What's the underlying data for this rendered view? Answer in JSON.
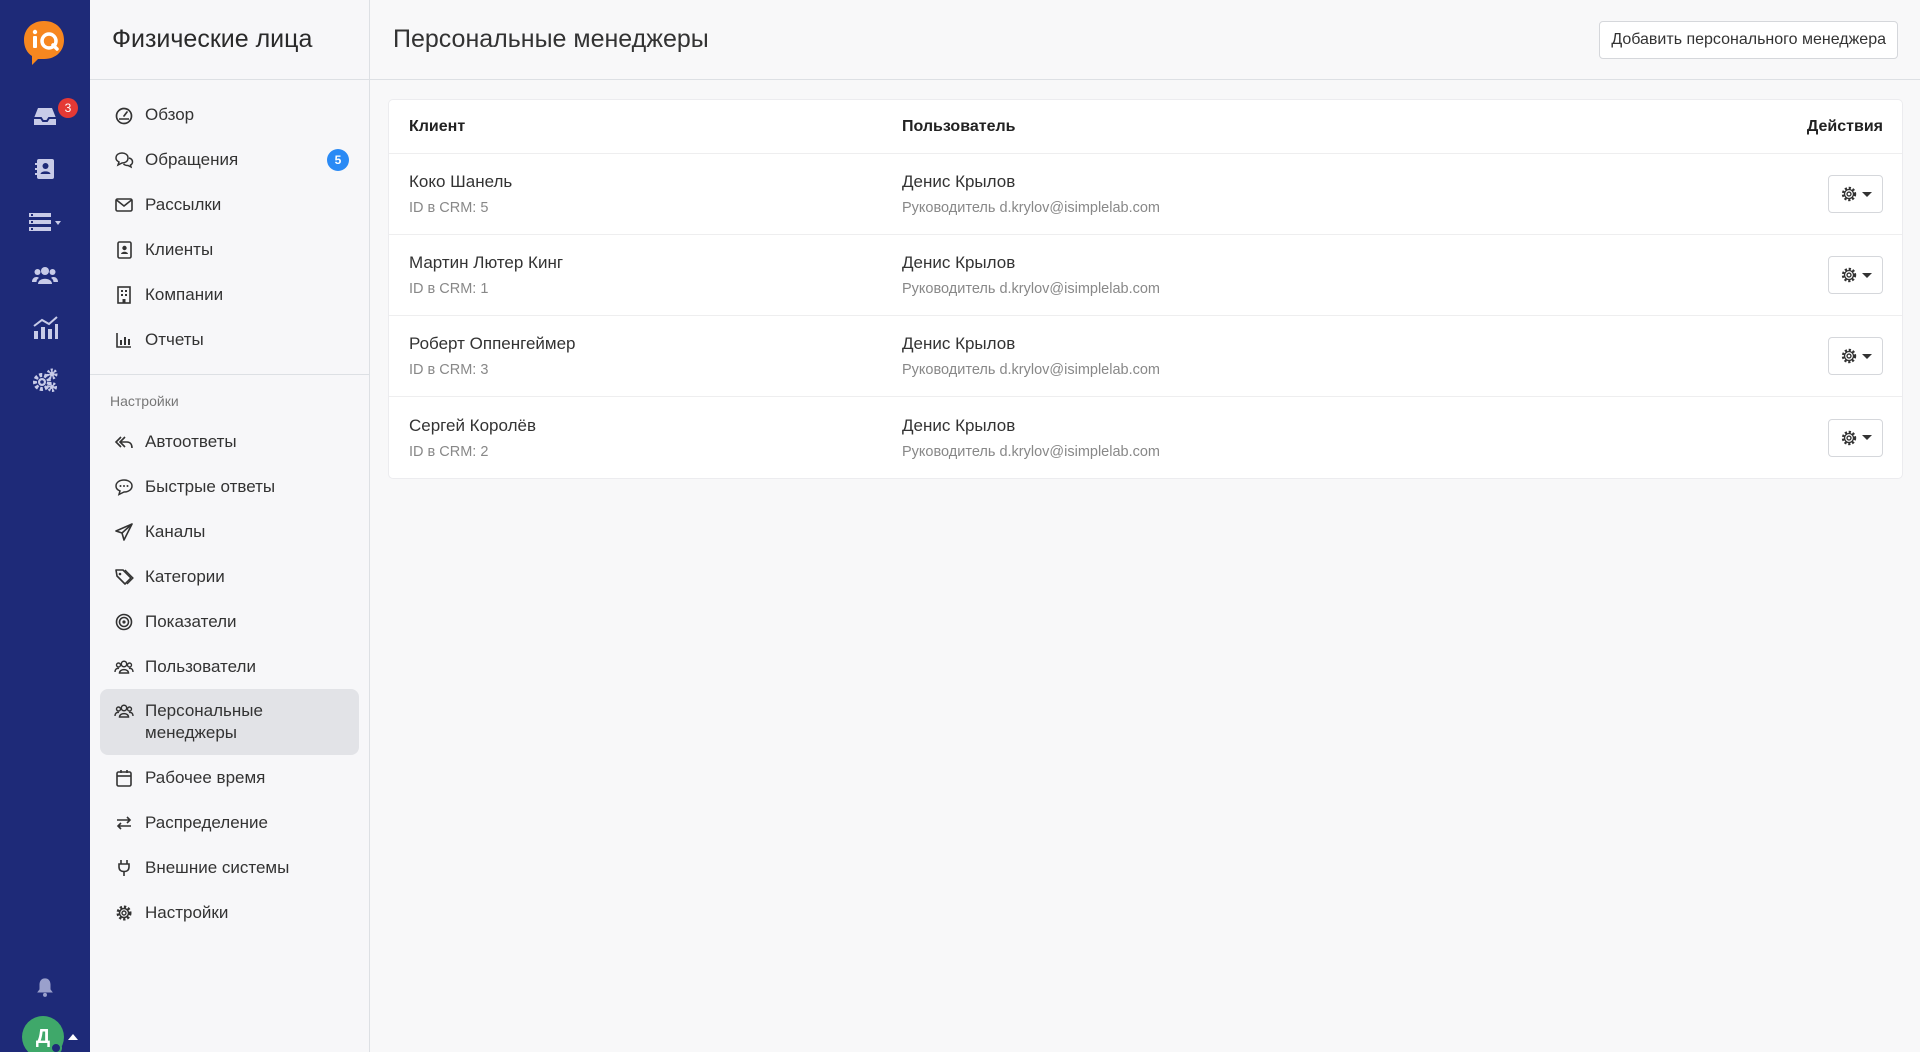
{
  "rail": {
    "inbox_badge": "3",
    "avatar_letter": "Д",
    "brand_color": "#f7871f"
  },
  "sidebar": {
    "title": "Физические лица",
    "items": [
      {
        "label": "Обзор",
        "icon": "dashboard-icon"
      },
      {
        "label": "Обращения",
        "icon": "chat-icon",
        "badge": "5"
      },
      {
        "label": "Рассылки",
        "icon": "mail-icon"
      },
      {
        "label": "Клиенты",
        "icon": "contact-icon"
      },
      {
        "label": "Компании",
        "icon": "building-icon"
      },
      {
        "label": "Отчеты",
        "icon": "bar-chart-icon"
      }
    ],
    "settings_label": "Настройки",
    "settings_items": [
      {
        "label": "Автоответы",
        "icon": "reply-all-icon"
      },
      {
        "label": "Быстрые ответы",
        "icon": "comment-dots-icon"
      },
      {
        "label": "Каналы",
        "icon": "send-icon"
      },
      {
        "label": "Категории",
        "icon": "tags-icon"
      },
      {
        "label": "Показатели",
        "icon": "target-icon"
      },
      {
        "label": "Пользователи",
        "icon": "users-icon"
      },
      {
        "label": "Персональные менеджеры",
        "icon": "users-icon",
        "active": true
      },
      {
        "label": "Рабочее время",
        "icon": "calendar-icon"
      },
      {
        "label": "Распределение",
        "icon": "exchange-icon"
      },
      {
        "label": "Внешние системы",
        "icon": "plug-icon"
      },
      {
        "label": "Настройки",
        "icon": "gear-icon"
      }
    ]
  },
  "main": {
    "title": "Персональные менеджеры",
    "add_button": "Добавить персонального менеджера",
    "columns": {
      "client": "Клиент",
      "user": "Пользователь",
      "actions": "Действия"
    },
    "rows": [
      {
        "client": "Коко Шанель",
        "crm": "ID в CRM: 5",
        "user": "Денис Крылов",
        "user_info": "Руководитель d.krylov@isimplelab.com"
      },
      {
        "client": "Мартин Лютер Кинг",
        "crm": "ID в CRM: 1",
        "user": "Денис Крылов",
        "user_info": "Руководитель d.krylov@isimplelab.com"
      },
      {
        "client": "Роберт Оппенгеймер",
        "crm": "ID в CRM: 3",
        "user": "Денис Крылов",
        "user_info": "Руководитель d.krylov@isimplelab.com"
      },
      {
        "client": "Сергей Королёв",
        "crm": "ID в CRM: 2",
        "user": "Денис Крылов",
        "user_info": "Руководитель d.krylov@isimplelab.com"
      }
    ]
  }
}
